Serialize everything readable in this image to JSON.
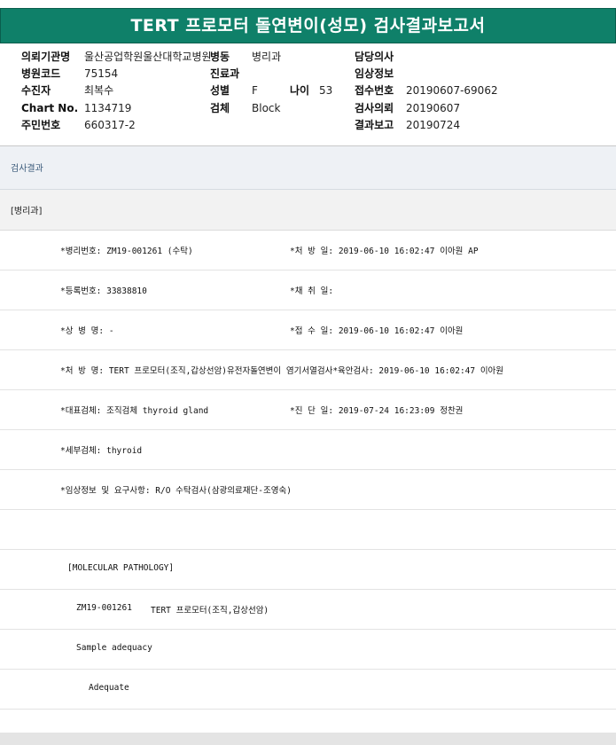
{
  "title": "TERT 프로모터 돌연변이(성모) 검사결과보고서",
  "header": {
    "institution_label": "의뢰기관명",
    "institution_value": "울산공업학원울산대학교병원",
    "ward_label": "병동",
    "ward_value": "병리과",
    "doctor_label": "담당의사",
    "hospital_code_label": "병원코드",
    "hospital_code_value": "75154",
    "dept_label": "진료과",
    "clinical_info_label": "임상정보",
    "patient_label": "수진자",
    "patient_value": "최복수",
    "sex_label": "성별",
    "sex_value": "F",
    "age_label": "나이",
    "age_value": "53",
    "receipt_no_label": "접수번호",
    "receipt_no_value": "20190607-69062",
    "chart_label": "Chart No.",
    "chart_value": "1134719",
    "specimen_label": "검체",
    "specimen_value": "Block",
    "request_label": "검사의뢰",
    "request_value": "20190607",
    "resident_label": "주민번호",
    "resident_value": "660317-2",
    "report_label": "결과보고",
    "report_value": "20190724"
  },
  "section_title": "검사결과",
  "dept_title": "[병리과]",
  "rows": {
    "r1_left": "*병리번호: ZM19-001261 (수탁)",
    "r1_right": "*처 방 일: 2019-06-10 16:02:47  이아원 AP",
    "r2_left": "*등록번호: 33838810",
    "r2_right": "*채 취 일:",
    "r3_left": "*상 병 명: -",
    "r3_right": "*접 수 일: 2019-06-10 16:02:47  이아원",
    "r4_full": "*처 방 명: TERT 프로모터(조직,갑상선암)유전자돌연변이 염기서열검사*육안검사: 2019-06-10 16:02:47  이아원",
    "r5_left": "*대표검체: 조직검체 thyroid gland",
    "r5_right": "*진 단 일: 2019-07-24 16:23:09  정찬권",
    "r6_left": "*세부검체: thyroid",
    "r7_left": "*임상정보 및 요구사항: R/O 수탁검사(삼광의료재단-조영숙)",
    "r9_left": "[MOLECULAR PATHOLOGY]",
    "r10_id": "ZM19-001261",
    "r10_name": "TERT 프로모터(조직,갑상선암)",
    "r11_left": "Sample adequacy",
    "r12_left": "Adequate"
  }
}
